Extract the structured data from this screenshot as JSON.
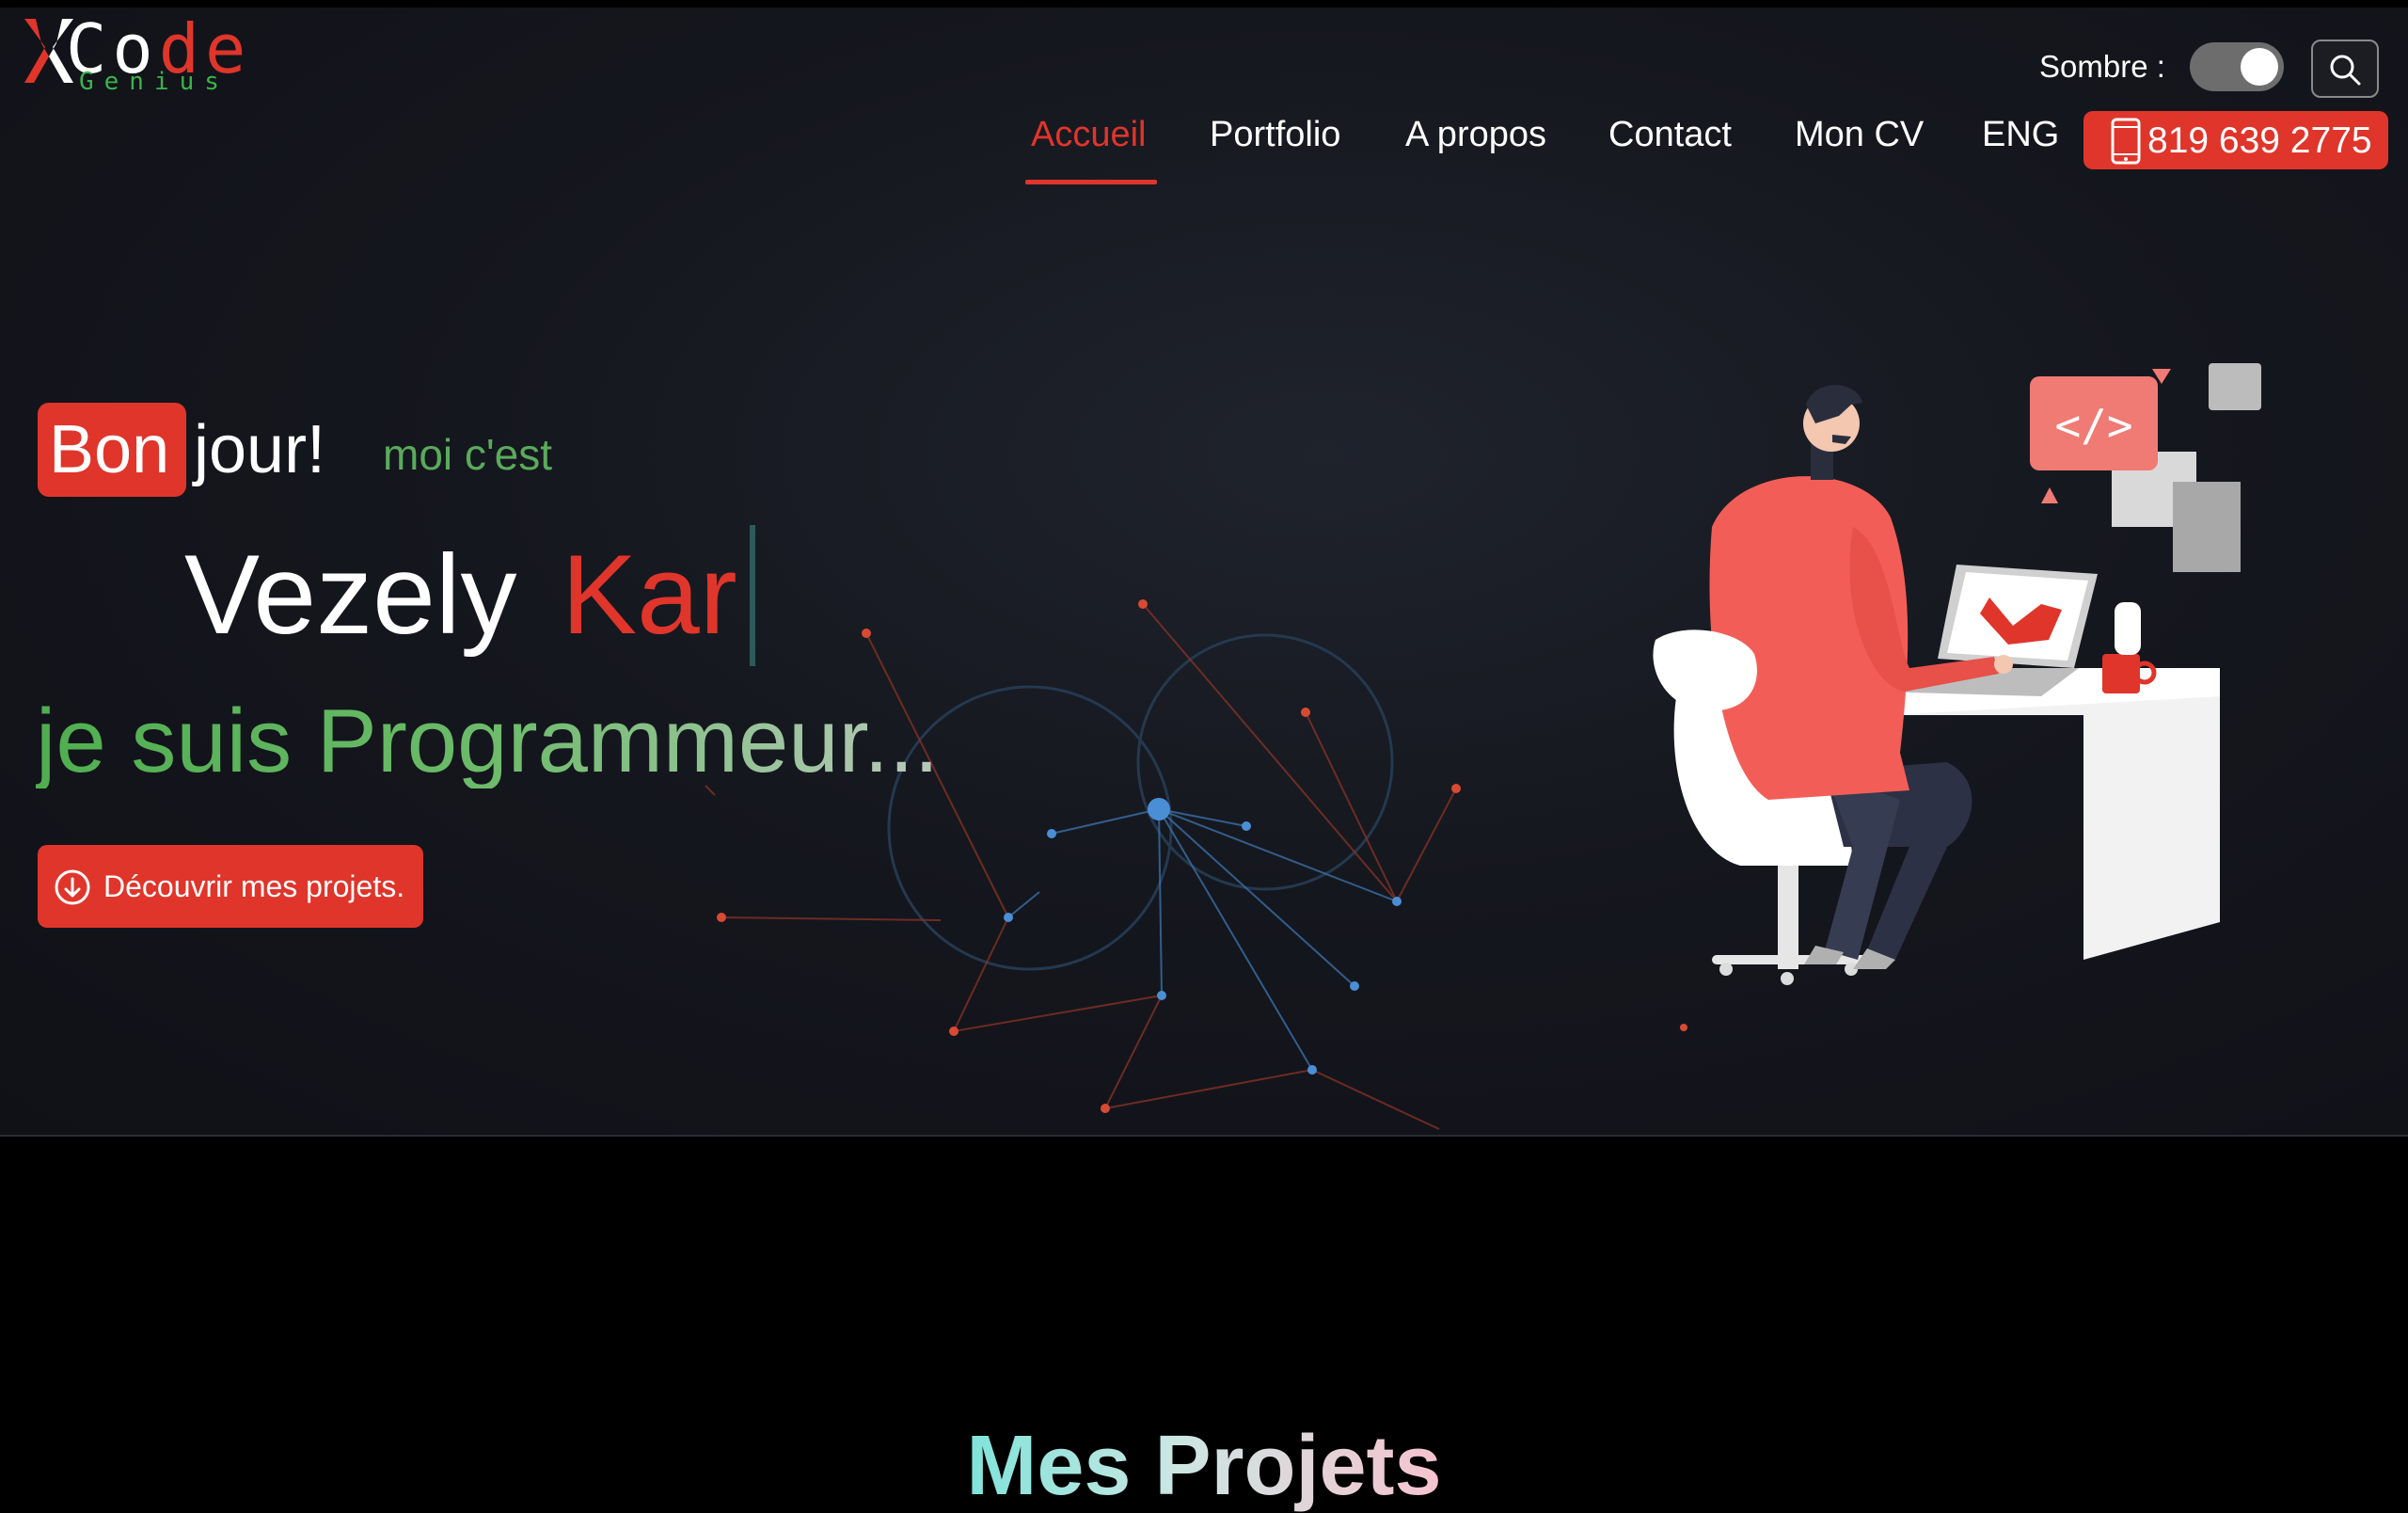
{
  "brand": {
    "logo_code": "Code",
    "logo_genius": "Genius"
  },
  "theme_toggle": {
    "label": "Sombre :",
    "enabled": true
  },
  "icons": {
    "search": "search-icon",
    "phone": "phone-icon",
    "download": "arrow-down-circle-icon"
  },
  "nav": {
    "items": [
      {
        "label": "Accueil",
        "active": true
      },
      {
        "label": "Portfolio"
      },
      {
        "label": "A propos"
      },
      {
        "label": "Contact"
      },
      {
        "label": "Mon CV"
      },
      {
        "label": "ENG"
      }
    ],
    "phone": "819 639 2775"
  },
  "hero": {
    "greeting_box": "Bon",
    "greeting_rest": "jour!",
    "intro": "moi c'est",
    "first_name": "Vezely",
    "last_name_typed": "Kar",
    "role": "je suis Programmeur...",
    "cta_label": "Découvrir mes projets."
  },
  "sections": {
    "projects_title": "Mes Projets"
  },
  "colors": {
    "accent": "#e0352b",
    "green": "#5ab55a",
    "background": "#15171e"
  }
}
